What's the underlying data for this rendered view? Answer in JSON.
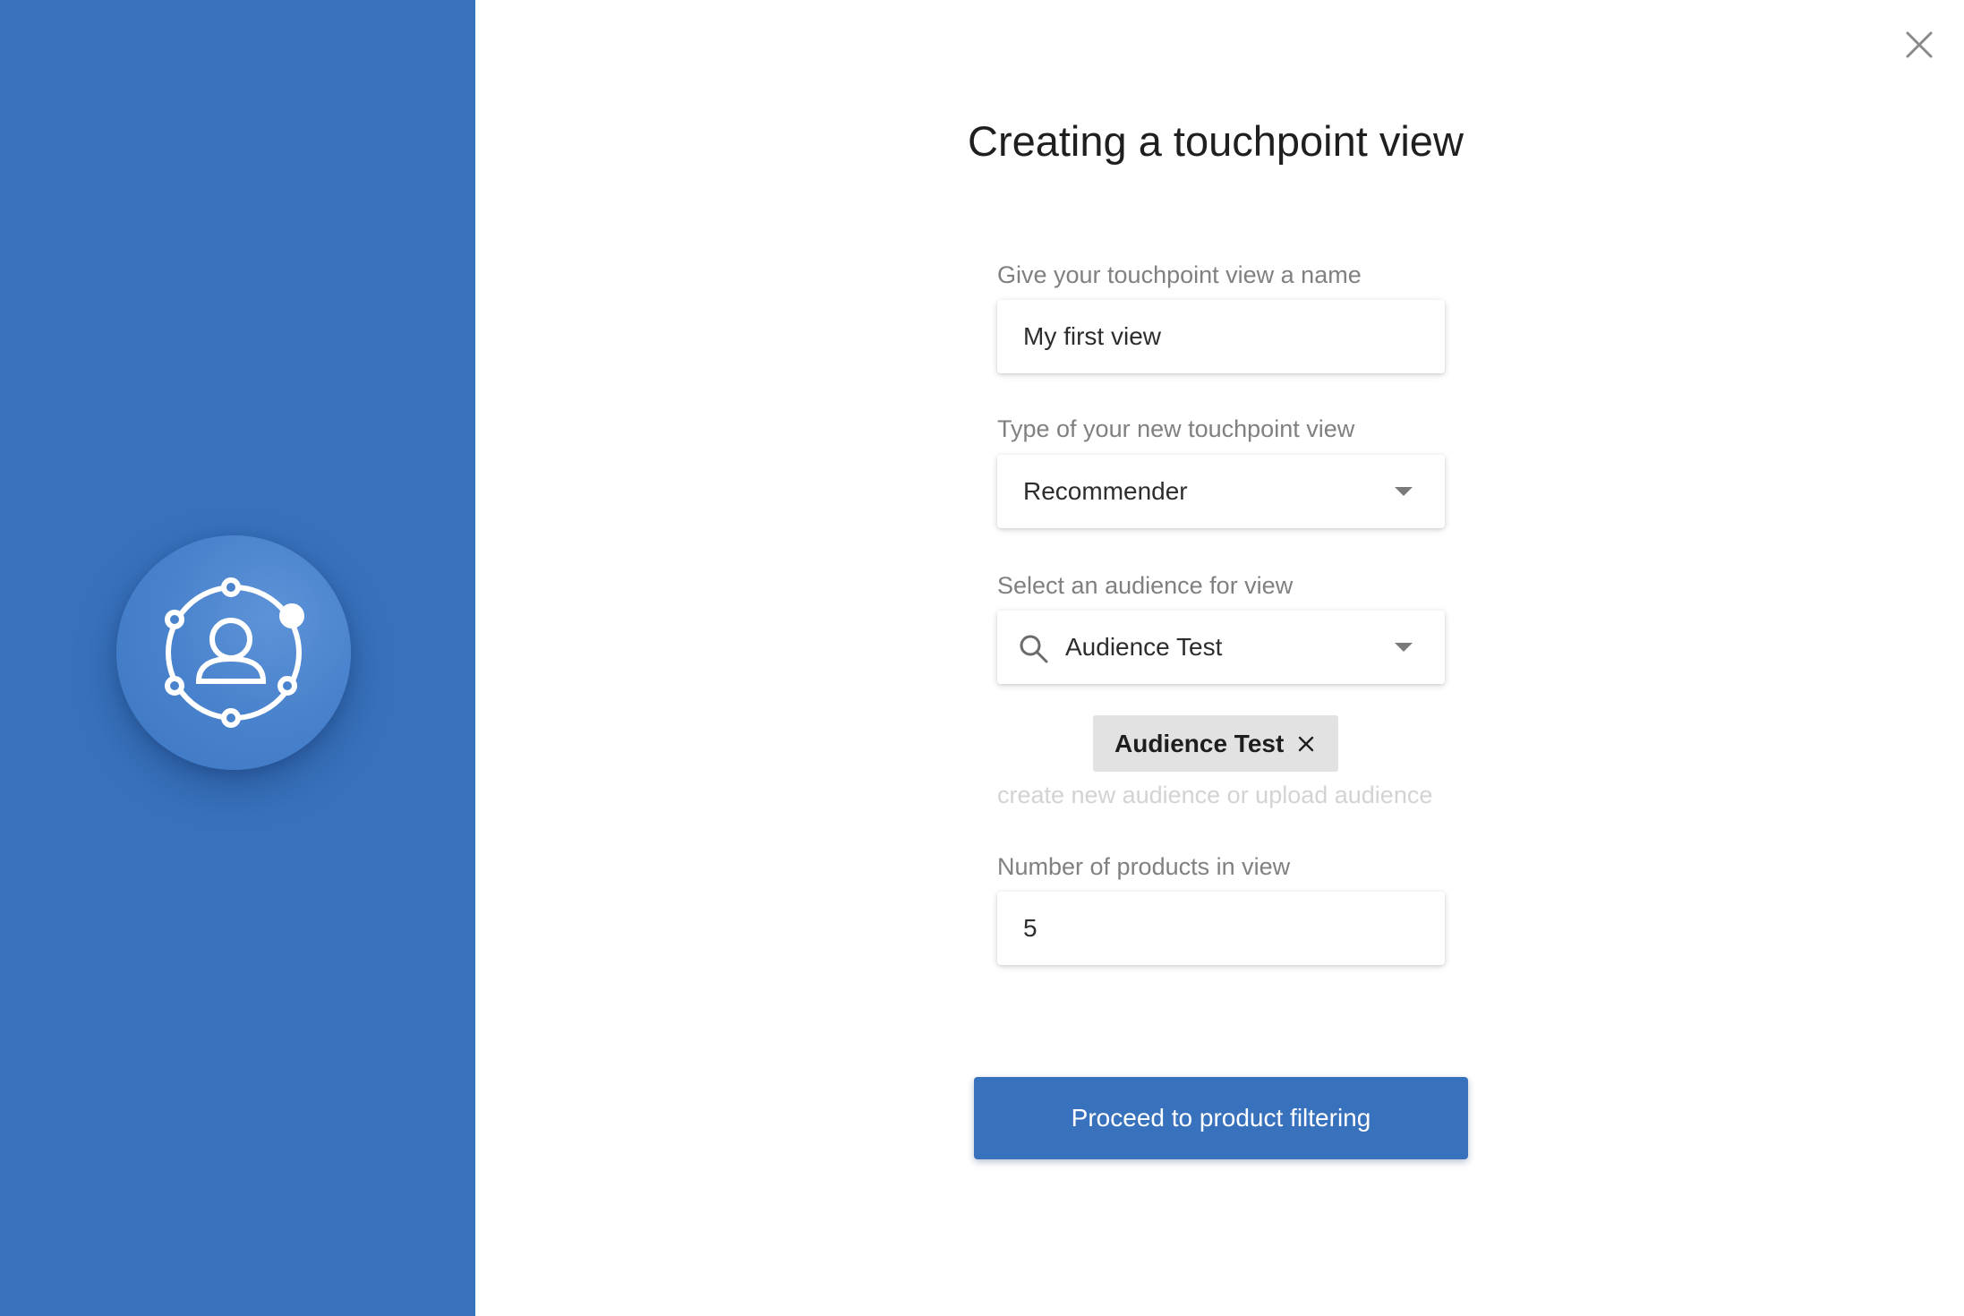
{
  "dialog": {
    "title": "Creating a touchpoint view",
    "close_icon": "close-icon"
  },
  "side_panel": {
    "icon": "audience-network-icon",
    "accent_color": "#3872bd"
  },
  "form": {
    "name_field": {
      "label": "Give your touchpoint view a name",
      "value": "My first view"
    },
    "type_field": {
      "label": "Type of your new touchpoint view",
      "value": "Recommender",
      "icon": "chevron-down-icon"
    },
    "audience_field": {
      "label": "Select an audience for view",
      "value": "Audience Test",
      "search_icon": "search-icon",
      "dropdown_icon": "chevron-down-icon"
    },
    "selected_audience_chip": {
      "label": "Audience Test",
      "remove_icon": "close-icon"
    },
    "helper_link": "create new audience or upload audience",
    "products_field": {
      "label": "Number of products in view",
      "value": "5"
    }
  },
  "actions": {
    "proceed_label": "Proceed to product filtering"
  }
}
